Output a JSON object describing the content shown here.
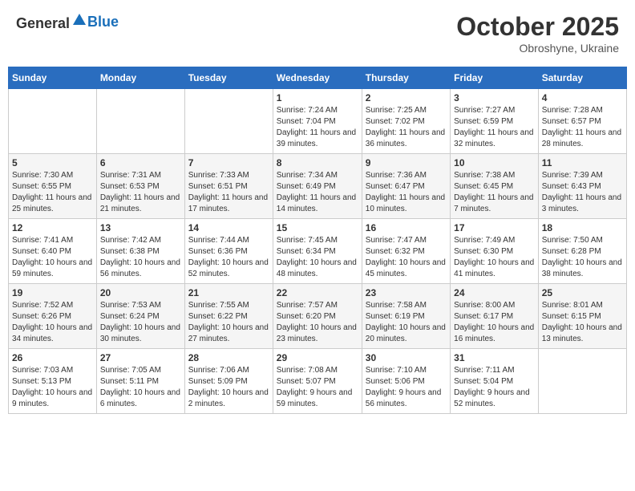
{
  "header": {
    "logo_general": "General",
    "logo_blue": "Blue",
    "month": "October 2025",
    "location": "Obroshyne, Ukraine"
  },
  "weekdays": [
    "Sunday",
    "Monday",
    "Tuesday",
    "Wednesday",
    "Thursday",
    "Friday",
    "Saturday"
  ],
  "weeks": [
    [
      {
        "day": "",
        "sunrise": "",
        "sunset": "",
        "daylight": ""
      },
      {
        "day": "",
        "sunrise": "",
        "sunset": "",
        "daylight": ""
      },
      {
        "day": "",
        "sunrise": "",
        "sunset": "",
        "daylight": ""
      },
      {
        "day": "1",
        "sunrise": "Sunrise: 7:24 AM",
        "sunset": "Sunset: 7:04 PM",
        "daylight": "Daylight: 11 hours and 39 minutes."
      },
      {
        "day": "2",
        "sunrise": "Sunrise: 7:25 AM",
        "sunset": "Sunset: 7:02 PM",
        "daylight": "Daylight: 11 hours and 36 minutes."
      },
      {
        "day": "3",
        "sunrise": "Sunrise: 7:27 AM",
        "sunset": "Sunset: 6:59 PM",
        "daylight": "Daylight: 11 hours and 32 minutes."
      },
      {
        "day": "4",
        "sunrise": "Sunrise: 7:28 AM",
        "sunset": "Sunset: 6:57 PM",
        "daylight": "Daylight: 11 hours and 28 minutes."
      }
    ],
    [
      {
        "day": "5",
        "sunrise": "Sunrise: 7:30 AM",
        "sunset": "Sunset: 6:55 PM",
        "daylight": "Daylight: 11 hours and 25 minutes."
      },
      {
        "day": "6",
        "sunrise": "Sunrise: 7:31 AM",
        "sunset": "Sunset: 6:53 PM",
        "daylight": "Daylight: 11 hours and 21 minutes."
      },
      {
        "day": "7",
        "sunrise": "Sunrise: 7:33 AM",
        "sunset": "Sunset: 6:51 PM",
        "daylight": "Daylight: 11 hours and 17 minutes."
      },
      {
        "day": "8",
        "sunrise": "Sunrise: 7:34 AM",
        "sunset": "Sunset: 6:49 PM",
        "daylight": "Daylight: 11 hours and 14 minutes."
      },
      {
        "day": "9",
        "sunrise": "Sunrise: 7:36 AM",
        "sunset": "Sunset: 6:47 PM",
        "daylight": "Daylight: 11 hours and 10 minutes."
      },
      {
        "day": "10",
        "sunrise": "Sunrise: 7:38 AM",
        "sunset": "Sunset: 6:45 PM",
        "daylight": "Daylight: 11 hours and 7 minutes."
      },
      {
        "day": "11",
        "sunrise": "Sunrise: 7:39 AM",
        "sunset": "Sunset: 6:43 PM",
        "daylight": "Daylight: 11 hours and 3 minutes."
      }
    ],
    [
      {
        "day": "12",
        "sunrise": "Sunrise: 7:41 AM",
        "sunset": "Sunset: 6:40 PM",
        "daylight": "Daylight: 10 hours and 59 minutes."
      },
      {
        "day": "13",
        "sunrise": "Sunrise: 7:42 AM",
        "sunset": "Sunset: 6:38 PM",
        "daylight": "Daylight: 10 hours and 56 minutes."
      },
      {
        "day": "14",
        "sunrise": "Sunrise: 7:44 AM",
        "sunset": "Sunset: 6:36 PM",
        "daylight": "Daylight: 10 hours and 52 minutes."
      },
      {
        "day": "15",
        "sunrise": "Sunrise: 7:45 AM",
        "sunset": "Sunset: 6:34 PM",
        "daylight": "Daylight: 10 hours and 48 minutes."
      },
      {
        "day": "16",
        "sunrise": "Sunrise: 7:47 AM",
        "sunset": "Sunset: 6:32 PM",
        "daylight": "Daylight: 10 hours and 45 minutes."
      },
      {
        "day": "17",
        "sunrise": "Sunrise: 7:49 AM",
        "sunset": "Sunset: 6:30 PM",
        "daylight": "Daylight: 10 hours and 41 minutes."
      },
      {
        "day": "18",
        "sunrise": "Sunrise: 7:50 AM",
        "sunset": "Sunset: 6:28 PM",
        "daylight": "Daylight: 10 hours and 38 minutes."
      }
    ],
    [
      {
        "day": "19",
        "sunrise": "Sunrise: 7:52 AM",
        "sunset": "Sunset: 6:26 PM",
        "daylight": "Daylight: 10 hours and 34 minutes."
      },
      {
        "day": "20",
        "sunrise": "Sunrise: 7:53 AM",
        "sunset": "Sunset: 6:24 PM",
        "daylight": "Daylight: 10 hours and 30 minutes."
      },
      {
        "day": "21",
        "sunrise": "Sunrise: 7:55 AM",
        "sunset": "Sunset: 6:22 PM",
        "daylight": "Daylight: 10 hours and 27 minutes."
      },
      {
        "day": "22",
        "sunrise": "Sunrise: 7:57 AM",
        "sunset": "Sunset: 6:20 PM",
        "daylight": "Daylight: 10 hours and 23 minutes."
      },
      {
        "day": "23",
        "sunrise": "Sunrise: 7:58 AM",
        "sunset": "Sunset: 6:19 PM",
        "daylight": "Daylight: 10 hours and 20 minutes."
      },
      {
        "day": "24",
        "sunrise": "Sunrise: 8:00 AM",
        "sunset": "Sunset: 6:17 PM",
        "daylight": "Daylight: 10 hours and 16 minutes."
      },
      {
        "day": "25",
        "sunrise": "Sunrise: 8:01 AM",
        "sunset": "Sunset: 6:15 PM",
        "daylight": "Daylight: 10 hours and 13 minutes."
      }
    ],
    [
      {
        "day": "26",
        "sunrise": "Sunrise: 7:03 AM",
        "sunset": "Sunset: 5:13 PM",
        "daylight": "Daylight: 10 hours and 9 minutes."
      },
      {
        "day": "27",
        "sunrise": "Sunrise: 7:05 AM",
        "sunset": "Sunset: 5:11 PM",
        "daylight": "Daylight: 10 hours and 6 minutes."
      },
      {
        "day": "28",
        "sunrise": "Sunrise: 7:06 AM",
        "sunset": "Sunset: 5:09 PM",
        "daylight": "Daylight: 10 hours and 2 minutes."
      },
      {
        "day": "29",
        "sunrise": "Sunrise: 7:08 AM",
        "sunset": "Sunset: 5:07 PM",
        "daylight": "Daylight: 9 hours and 59 minutes."
      },
      {
        "day": "30",
        "sunrise": "Sunrise: 7:10 AM",
        "sunset": "Sunset: 5:06 PM",
        "daylight": "Daylight: 9 hours and 56 minutes."
      },
      {
        "day": "31",
        "sunrise": "Sunrise: 7:11 AM",
        "sunset": "Sunset: 5:04 PM",
        "daylight": "Daylight: 9 hours and 52 minutes."
      },
      {
        "day": "",
        "sunrise": "",
        "sunset": "",
        "daylight": ""
      }
    ]
  ]
}
